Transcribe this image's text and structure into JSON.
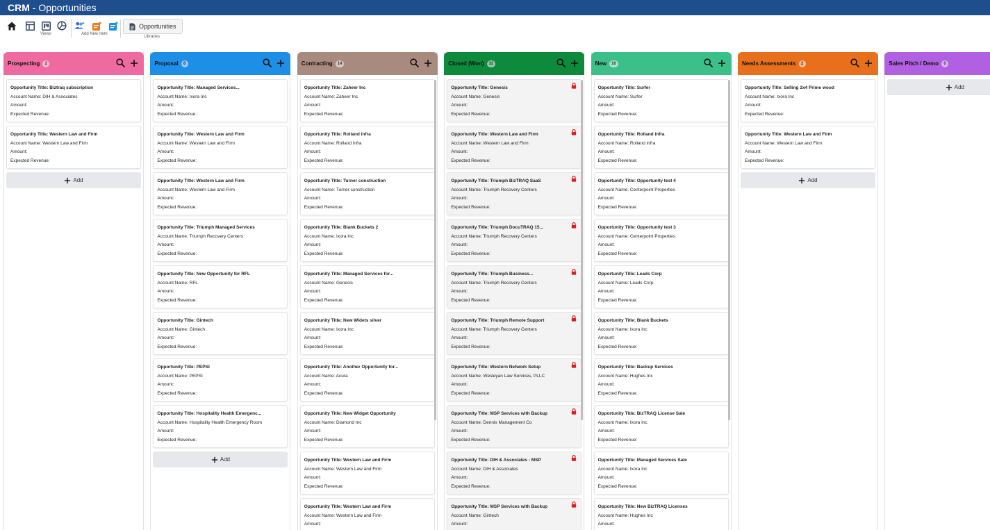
{
  "app": {
    "title_bold": "CRM",
    "title_rest": " - Opportunities"
  },
  "ribbon": {
    "views_label": "Views",
    "add_new_label": "Add New Item",
    "library_button": "Opportunities",
    "libraries_label": "Libraries"
  },
  "labels": {
    "title": "Opportunity Title: ",
    "account": "Account Name: ",
    "amount": "Amount:",
    "revenue": "Expected Revenue:",
    "add": "Add"
  },
  "colors": {
    "prospecting": "#f06aa2",
    "proposal": "#1e8fe6",
    "contracting": "#a88a7f",
    "closed_won": "#0d8a3c",
    "new": "#3cc08a",
    "needs_assessments": "#e8701c",
    "sales_pitch": "#b060e0",
    "lock": "#d91e1e"
  },
  "columns": [
    {
      "name": "Prospecting",
      "count": "2",
      "color": "#f06aa2",
      "locked": false,
      "cards": [
        {
          "title": "Biztraq subscription",
          "account": "DIH & Associates"
        },
        {
          "title": "Western Law and Firm",
          "account": "Western Law and Firm"
        }
      ]
    },
    {
      "name": "Proposal",
      "count": "8",
      "color": "#1e8fe6",
      "locked": false,
      "cards": [
        {
          "title": "Managed Services...",
          "account": "Ixora Inc"
        },
        {
          "title": "Western Law and Firm",
          "account": "Western Law and Firm"
        },
        {
          "title": "Western Law and Firm",
          "account": "Western Law and Firm"
        },
        {
          "title": "Triumph Managed Services",
          "account": "Triumph Recovery Centers"
        },
        {
          "title": "New Opportunity for RFL",
          "account": "RFL"
        },
        {
          "title": "Gintech",
          "account": "Gintech"
        },
        {
          "title": "PEPSI",
          "account": "PEPSI"
        },
        {
          "title": "Hospitality Health Emergenc...",
          "account": "Hospitality Health Emergency Room"
        }
      ]
    },
    {
      "name": "Contracting",
      "count": "14",
      "color": "#a88a7f",
      "locked": false,
      "cards": [
        {
          "title": "Zaheer Inc",
          "account": "Zaheer Inc"
        },
        {
          "title": "Rolland infra",
          "account": "Rolland infra"
        },
        {
          "title": "Turner construction",
          "account": "Turner construction"
        },
        {
          "title": "Blank Buckets 2",
          "account": "Ixora Inc"
        },
        {
          "title": "Managed Services for...",
          "account": "Genesis"
        },
        {
          "title": "New Widets silver",
          "account": "Ixora Inc"
        },
        {
          "title": "Another Opportunity for...",
          "account": "Acura"
        },
        {
          "title": "New Widget Opportunity",
          "account": "Diamond Inc"
        },
        {
          "title": "Western Law and Firm",
          "account": "Western Law and Firm"
        },
        {
          "title": "Western Law and Firm",
          "account": "Western Law and Firm"
        }
      ]
    },
    {
      "name": "Closed (Won)",
      "count": "32",
      "color": "#0d8a3c",
      "locked": true,
      "cards": [
        {
          "title": "Genesis",
          "account": "Genesis"
        },
        {
          "title": "Western Law and Firm",
          "account": "Western Law and Firm"
        },
        {
          "title": "Triumph BizTRAQ SaaS",
          "account": "Triumph Recovery Centers"
        },
        {
          "title": "Triumph DocuTRAQ 15...",
          "account": "Triumph Recovery Centers"
        },
        {
          "title": "Triumph Business...",
          "account": "Triumph Recovery Centers"
        },
        {
          "title": "Triumph Remote Support",
          "account": "Triumph Recovery Centers"
        },
        {
          "title": "Western Network Setup",
          "account": "Wesleyan Law Services, PLLC"
        },
        {
          "title": "MSP Services with Backup",
          "account": "Dennis Management Co"
        },
        {
          "title": "DIH & Associates - MSP",
          "account": "DIH & Associates"
        },
        {
          "title": "MSP Services with Backup",
          "account": "Gintech"
        }
      ]
    },
    {
      "name": "New",
      "count": "16",
      "color": "#3cc08a",
      "locked": false,
      "cards": [
        {
          "title": "Surfer",
          "account": "Surfer"
        },
        {
          "title": "Rolland infra",
          "account": "Rolland infra"
        },
        {
          "title": "Opportunity test 4",
          "account": "Centerpoint Properties"
        },
        {
          "title": "Opportunity test 3",
          "account": "Centerpoint Properties"
        },
        {
          "title": "Leads Corp",
          "account": "Leads Corp"
        },
        {
          "title": "Blank Buckets",
          "account": "Ixora Inc"
        },
        {
          "title": "Backup Services",
          "account": "Hughes Inc"
        },
        {
          "title": "BizTRAQ License Sale",
          "account": "Ixora Inc"
        },
        {
          "title": "Managed Services Sale",
          "account": "Ixora Inc"
        },
        {
          "title": "New BizTRAQ Licenses",
          "account": "Hughes Inc"
        }
      ]
    },
    {
      "name": "Needs Assessments",
      "count": "2",
      "color": "#e8701c",
      "locked": false,
      "cards": [
        {
          "title": "Selling 2x4 Prime wood",
          "account": "Ixora Inc"
        },
        {
          "title": "Western Law and Firm",
          "account": "Western Law and Firm"
        }
      ]
    },
    {
      "name": "Sales Pitch / Demo",
      "count": "0",
      "color": "#b060e0",
      "locked": false,
      "cards": []
    }
  ]
}
